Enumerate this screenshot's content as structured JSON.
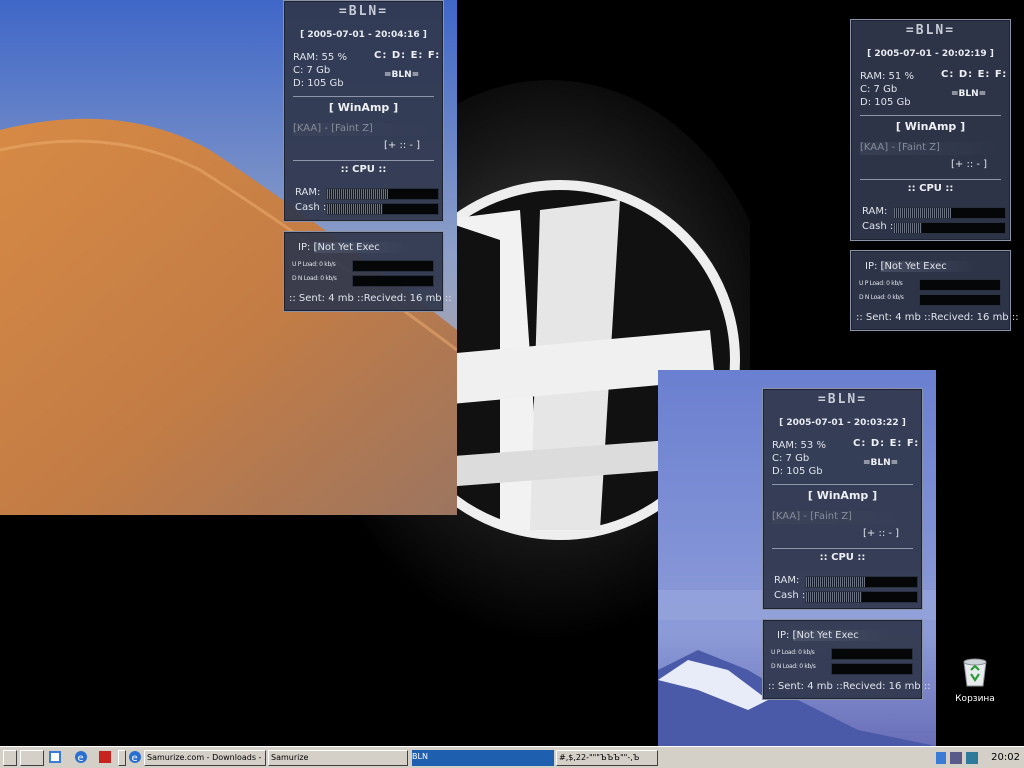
{
  "widgets": [
    {
      "title": "=BLN=",
      "datetime": "[ 2005-07-01 - 20:04:16 ]",
      "ram": "RAM: 55 %",
      "c": "C: 7 Gb",
      "d": "D: 105 Gb",
      "drives": "C: D: E: F:",
      "bln": "=BLN=",
      "winamp": "[ WinAmp ]",
      "track": "[KAA] - [Faint Z]",
      "controls": "[+ :: - ]",
      "cpu": ":: CPU ::",
      "ram_label": "RAM:",
      "cash_label": "Cash :",
      "ram_level": 0.55,
      "cash_level": 0.5,
      "ip_label": "IP:",
      "ip": "[Not Yet Exec",
      "upload": "U P Load: 0 kb/s",
      "download": "D N Load: 0 kb/s",
      "sent_recv": ":: Sent: 4 mb ::Recived: 16 mb ::"
    },
    {
      "title": "=BLN=",
      "datetime": "[ 2005-07-01 - 20:02:19 ]",
      "ram": "RAM: 51 %",
      "c": "C: 7 Gb",
      "d": "D: 105 Gb",
      "drives": "C: D: E: F:",
      "bln": "=BLN=",
      "winamp": "[ WinAmp ]",
      "track": "[KAA] - [Faint Z]",
      "controls": "[+ :: - ]",
      "cpu": ":: CPU ::",
      "ram_label": "RAM:",
      "cash_label": "Cash :",
      "ram_level": 0.51,
      "cash_level": 0.25,
      "ip_label": "IP:",
      "ip": "[Not Yet Exec",
      "upload": "U P Load: 0 kb/s",
      "download": "D N Load: 0 kb/s",
      "sent_recv": ":: Sent: 4 mb ::Recived: 16 mb ::"
    },
    {
      "title": "=BLN=",
      "datetime": "[ 2005-07-01 - 20:03:22 ]",
      "ram": "RAM: 53 %",
      "c": "C: 7 Gb",
      "d": "D: 105 Gb",
      "drives": "C: D: E: F:",
      "bln": "=BLN=",
      "winamp": "[ WinAmp ]",
      "track": "[KAA] - [Faint Z]",
      "controls": "[+ :: - ]",
      "cpu": ":: CPU ::",
      "ram_label": "RAM:",
      "cash_label": "Cash :",
      "ram_level": 0.53,
      "cash_level": 0.5,
      "ip_label": "IP:",
      "ip": "[Not Yet Exec",
      "upload": "U P Load: 0 kb/s",
      "download": "D N Load: 0 kb/s",
      "sent_recv": ":: Sent: 4 mb ::Recived: 16 mb ::"
    }
  ],
  "desktop": {
    "recycle_bin_label": "Корзина",
    "recycle_bin_icon": "recycle-bin-icon"
  },
  "taskbar": {
    "tasks": [
      {
        "label": "Samurize.com - Downloads - ...",
        "active": false
      },
      {
        "label": "Samurize",
        "active": false
      },
      {
        "label": "BLN",
        "active": true
      },
      {
        "label": "#,$,22-\"\"\"ЪЪЪ\"\"-,Ъ",
        "active": false
      }
    ],
    "clock": "20:02",
    "colors": {
      "taskbar_bg": "#d4d0c8",
      "active_task": "#1f5fb0"
    }
  }
}
